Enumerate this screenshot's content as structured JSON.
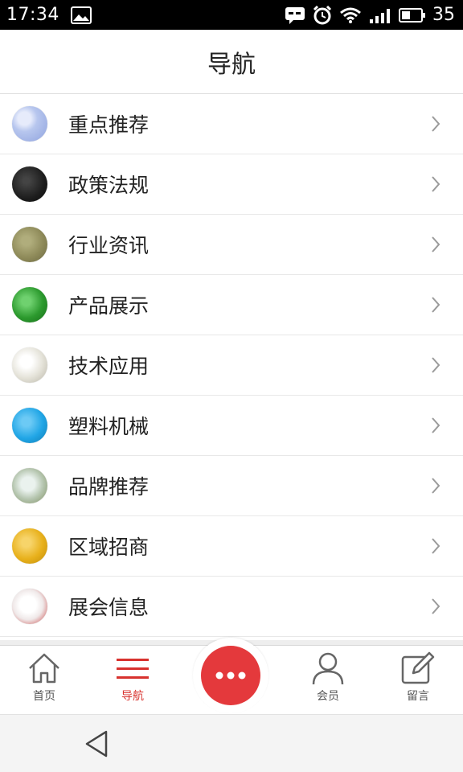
{
  "status_bar": {
    "time": "17:34",
    "battery": "35",
    "icons": [
      "image-icon",
      "message-icon",
      "alarm-icon",
      "wifi-icon",
      "signal-icon",
      "battery-icon"
    ]
  },
  "header": {
    "title": "导航"
  },
  "nav": {
    "items": [
      {
        "label": "重点推荐",
        "thumb_color": "#b7c6ee"
      },
      {
        "label": "政策法规",
        "thumb_color": "#222222"
      },
      {
        "label": "行业资讯",
        "thumb_color": "#8f8b5a"
      },
      {
        "label": "产品展示",
        "thumb_color": "#2c9a2e"
      },
      {
        "label": "技术应用",
        "thumb_color": "#e4e2d8"
      },
      {
        "label": "塑料机械",
        "thumb_color": "#21a6e6"
      },
      {
        "label": "品牌推荐",
        "thumb_color": "#b6c6b0"
      },
      {
        "label": "区域招商",
        "thumb_color": "#e8b11c"
      },
      {
        "label": "展会信息",
        "thumb_color": "#efe8e8"
      }
    ]
  },
  "tabbar": {
    "home": "首页",
    "nav": "导航",
    "member": "会员",
    "message": "留言",
    "accent": "#d8322e"
  }
}
